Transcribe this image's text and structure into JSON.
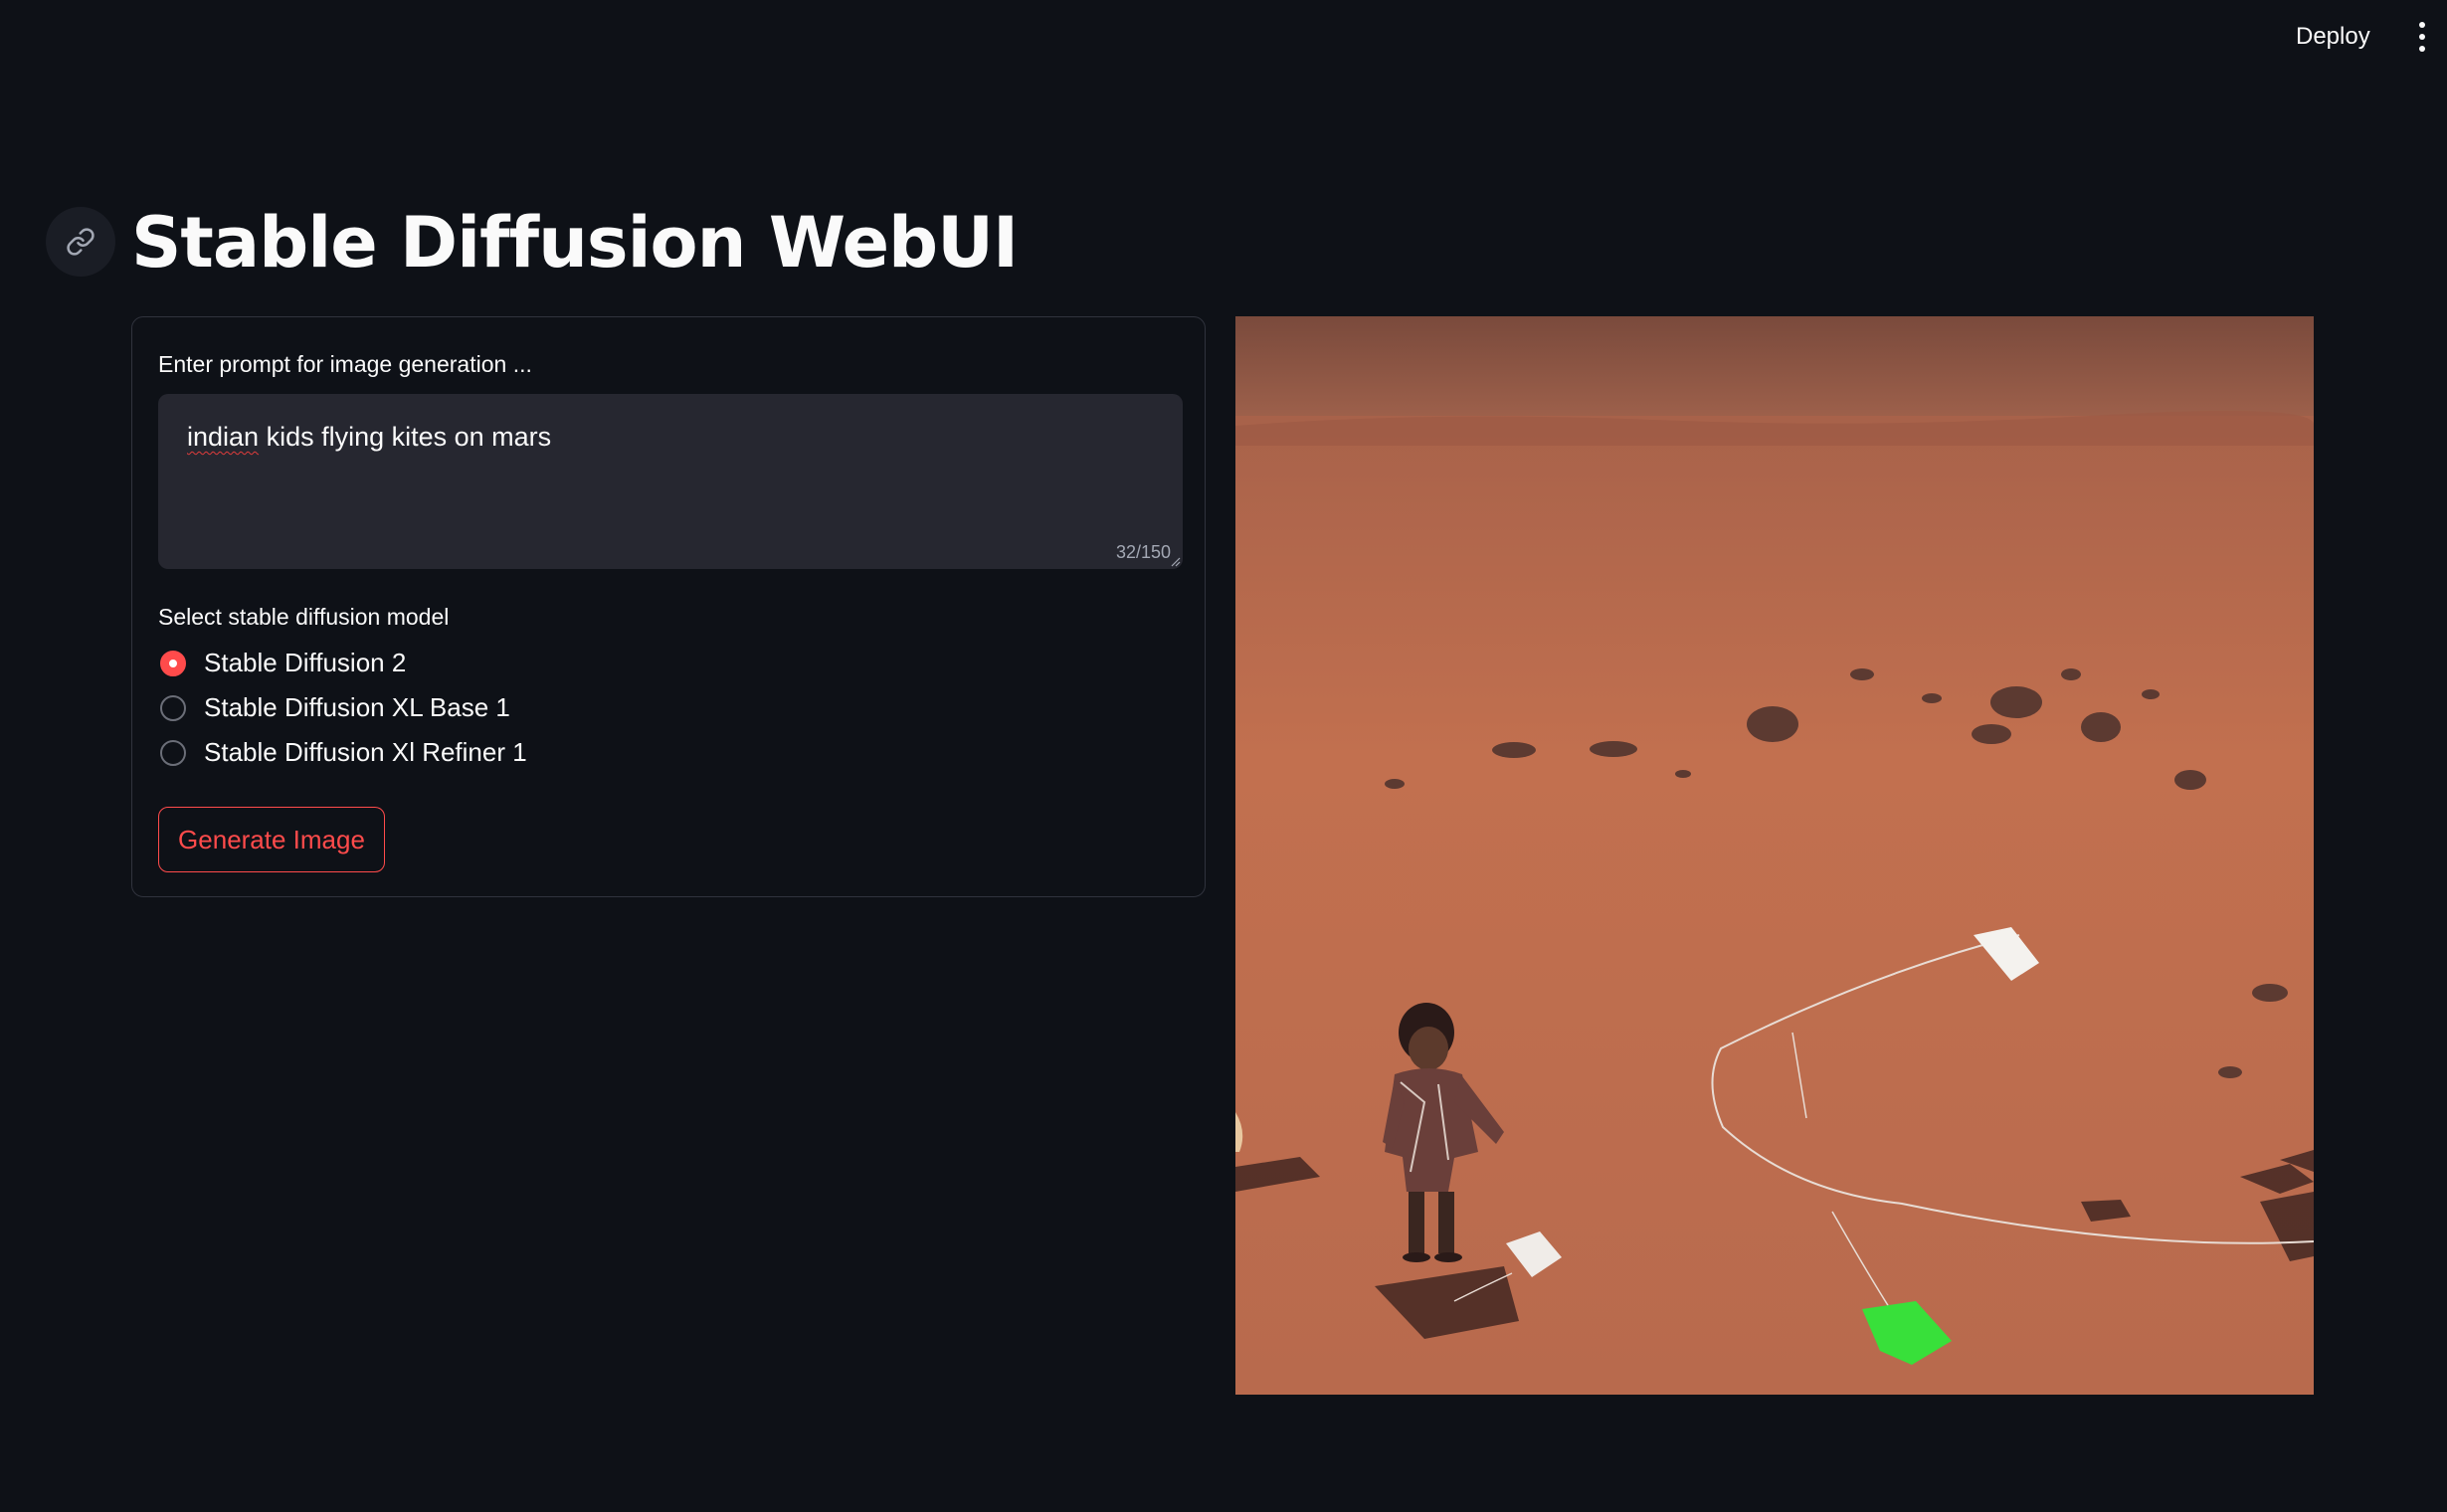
{
  "header": {
    "deploy_label": "Deploy",
    "menu_icon": "vertical-ellipsis-icon"
  },
  "page": {
    "title": "Stable Diffusion WebUI",
    "anchor_icon": "link-icon"
  },
  "form": {
    "prompt_label": "Enter prompt for image generation ...",
    "prompt_misspelled_word": "indian",
    "prompt_rest": " kids flying kites on mars",
    "prompt_value": "indian kids flying kites on mars",
    "char_count": "32/150",
    "model_label": "Select stable diffusion model",
    "models": [
      {
        "label": "Stable Diffusion 2",
        "selected": true
      },
      {
        "label": "Stable Diffusion XL Base 1",
        "selected": false
      },
      {
        "label": "Stable Diffusion Xl Refiner 1",
        "selected": false
      }
    ],
    "generate_label": "Generate Image"
  },
  "colors": {
    "background": "#0e1117",
    "accent": "#ff4b4b",
    "input_bg": "#262730",
    "border": "#30333d"
  },
  "image": {
    "subject": "generated-mars-kite-image"
  }
}
